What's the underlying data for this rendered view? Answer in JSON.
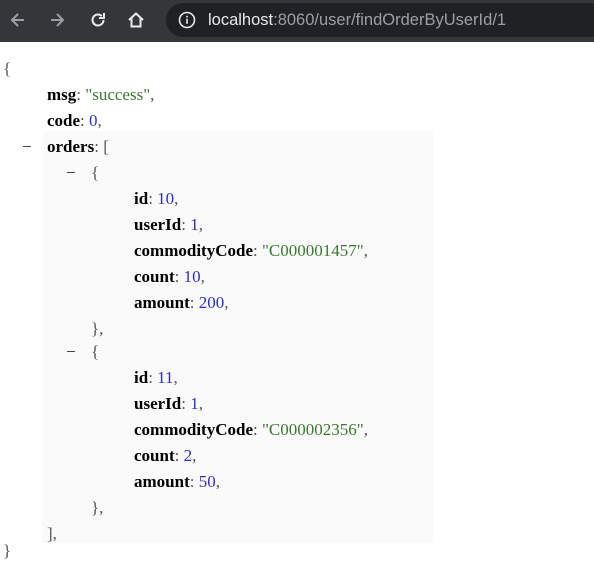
{
  "browser": {
    "url_host": "localhost",
    "url_path": ":8060/user/findOrderByUserId/1",
    "icons": [
      "back-arrow-icon",
      "forward-arrow-icon",
      "reload-icon",
      "home-icon",
      "info-icon"
    ]
  },
  "json": {
    "open_brace": "{",
    "close_brace": "}",
    "msg_key": "msg",
    "msg_value": "\"success\"",
    "code_key": "code",
    "code_value": "0",
    "orders_key": "orders",
    "orders_open": "[",
    "orders_close": "],",
    "toggle": "−",
    "orders": [
      {
        "open": "{",
        "close": "},",
        "id_key": "id",
        "id_value": "10",
        "userId_key": "userId",
        "userId_value": "1",
        "commodityCode_key": "commodityCode",
        "commodityCode_value": "\"C000001457\"",
        "count_key": "count",
        "count_value": "10",
        "amount_key": "amount",
        "amount_value": "200"
      },
      {
        "open": "{",
        "close": "},",
        "id_key": "id",
        "id_value": "11",
        "userId_key": "userId",
        "userId_value": "1",
        "commodityCode_key": "commodityCode",
        "commodityCode_value": "\"C000002356\"",
        "count_key": "count",
        "count_value": "2",
        "amount_key": "amount",
        "amount_value": "50"
      }
    ]
  }
}
